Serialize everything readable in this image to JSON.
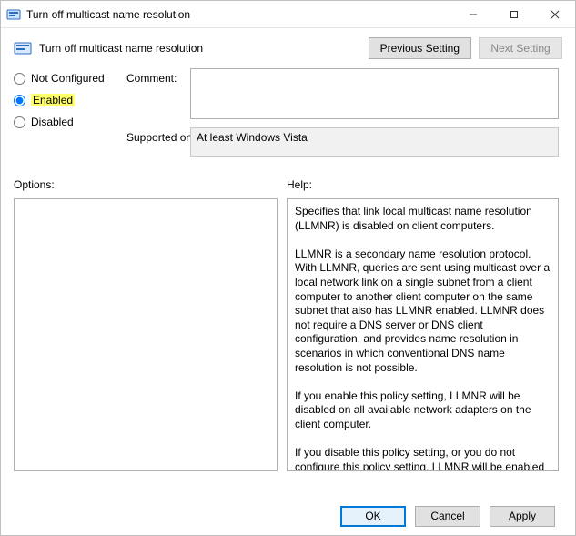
{
  "window": {
    "title": "Turn off multicast name resolution"
  },
  "header": {
    "subtitle": "Turn off multicast name resolution",
    "previous_button": "Previous Setting",
    "next_button": "Next Setting"
  },
  "state": {
    "options": {
      "not_configured": "Not Configured",
      "enabled": "Enabled",
      "disabled": "Disabled"
    },
    "selected": "enabled",
    "highlighted": "enabled"
  },
  "labels": {
    "comment": "Comment:",
    "supported_on": "Supported on:",
    "options": "Options:",
    "help": "Help:"
  },
  "comment": "",
  "supported_on": "At least Windows Vista",
  "help_text": "Specifies that link local multicast name resolution (LLMNR) is disabled on client computers.\n\nLLMNR is a secondary name resolution protocol. With LLMNR, queries are sent using multicast over a local network link on a single subnet from a client computer to another client computer on the same subnet that also has LLMNR enabled. LLMNR does not require a DNS server or DNS client configuration, and provides name resolution in scenarios in which conventional DNS name resolution is not possible.\n\nIf you enable this policy setting, LLMNR will be disabled on all available network adapters on the client computer.\n\nIf you disable this policy setting, or you do not configure this policy setting, LLMNR will be enabled on all available network adapters.",
  "footer": {
    "ok": "OK",
    "cancel": "Cancel",
    "apply": "Apply"
  }
}
